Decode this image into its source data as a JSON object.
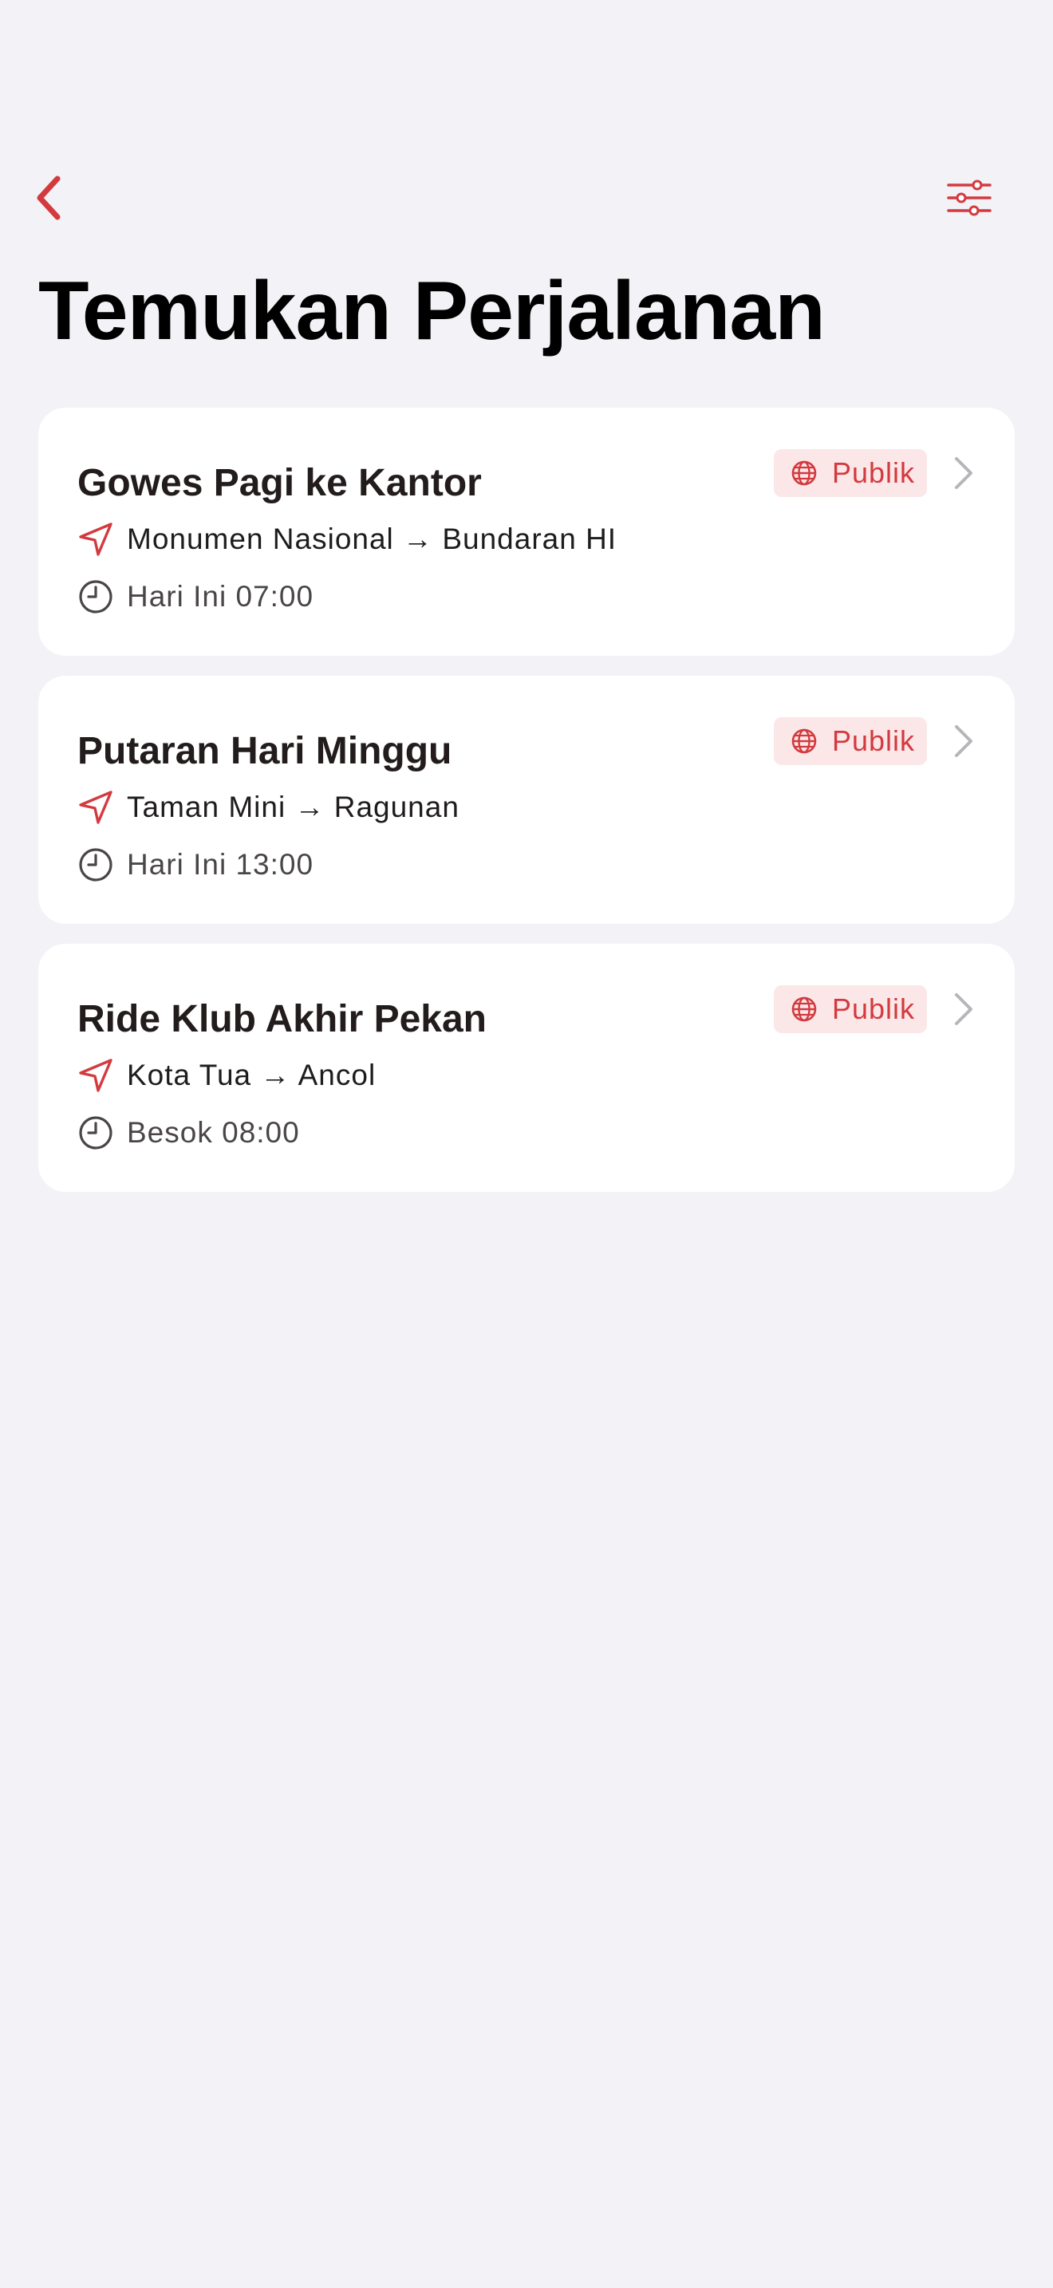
{
  "title": "Temukan Perjalanan",
  "nav": {
    "back_icon": "chevron-left-icon",
    "filter_icon": "sliders-icon"
  },
  "colors": {
    "accent": "#d33a3f",
    "background": "#f2f2f7",
    "card": "#ffffff",
    "badge_bg": "#fbe7e8"
  },
  "rides": [
    {
      "name": "Gowes Pagi ke Kantor",
      "visibility": "Publik",
      "route": "Monumen Nasional → Bundaran HI",
      "time": "Hari Ini 07:00"
    },
    {
      "name": "Putaran Hari Minggu",
      "visibility": "Publik",
      "route": "Taman Mini → Ragunan",
      "time": "Hari Ini 13:00"
    },
    {
      "name": "Ride Klub Akhir Pekan",
      "visibility": "Publik",
      "route": "Kota Tua → Ancol",
      "time": "Besok 08:00"
    }
  ]
}
